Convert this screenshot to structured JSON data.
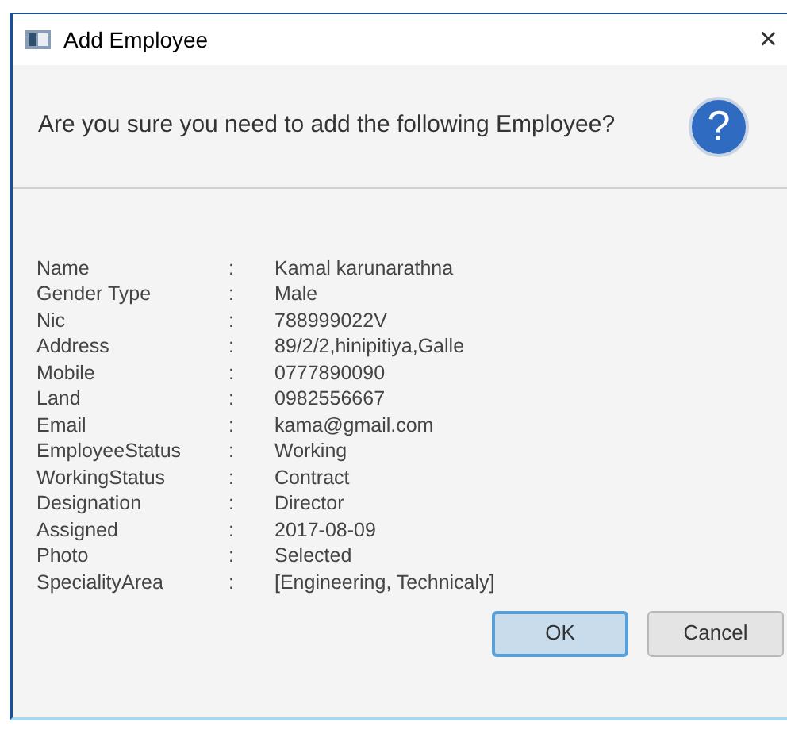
{
  "window": {
    "title": "Add Employee",
    "close": "×"
  },
  "header": {
    "message": "Are you sure you need to add the following Employee?",
    "icon": "?"
  },
  "separator": ":",
  "fields": [
    {
      "label": "Name",
      "value": "Kamal karunarathna"
    },
    {
      "label": "Gender Type",
      "value": "Male"
    },
    {
      "label": "Nic",
      "value": "788999022V"
    },
    {
      "label": "Address",
      "value": "89/2/2,hinipitiya,Galle"
    },
    {
      "label": "Mobile",
      "value": "0777890090"
    },
    {
      "label": "Land",
      "value": "0982556667"
    },
    {
      "label": "Email",
      "value": "kama@gmail.com"
    },
    {
      "label": "EmployeeStatus",
      "value": "Working"
    },
    {
      "label": "WorkingStatus",
      "value": "Contract"
    },
    {
      "label": "Designation",
      "value": "Director"
    },
    {
      "label": "Assigned",
      "value": "2017-08-09"
    },
    {
      "label": "Photo",
      "value": "Selected"
    },
    {
      "label": "SpecialityArea",
      "value": "[Engineering, Technicaly]"
    }
  ],
  "buttons": [
    {
      "label": "OK",
      "default": true
    },
    {
      "label": "Cancel",
      "default": false
    }
  ]
}
